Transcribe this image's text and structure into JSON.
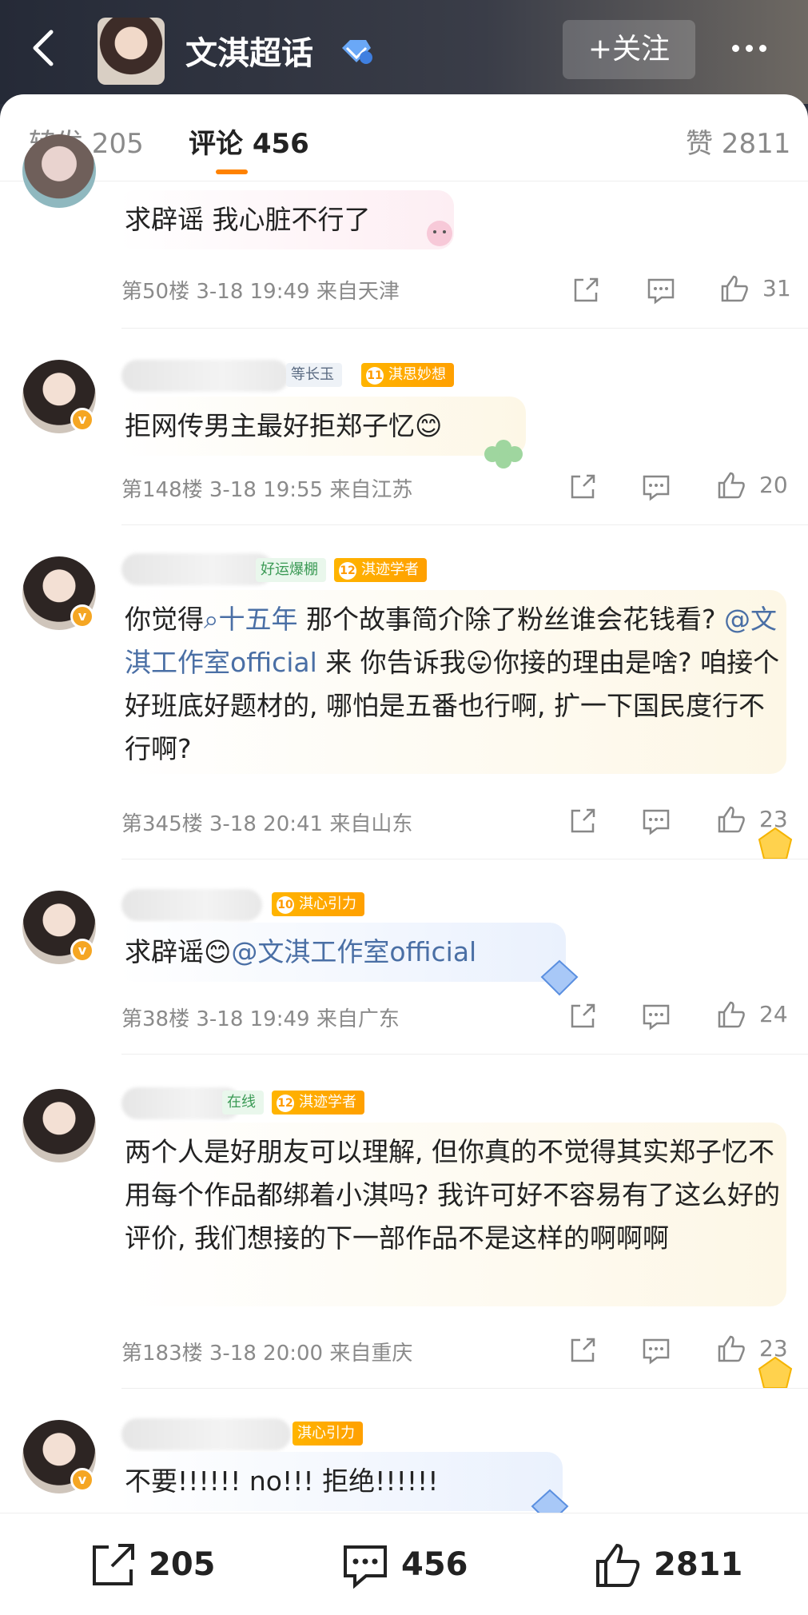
{
  "header": {
    "title": "文淇超话",
    "follow_label": "+关注"
  },
  "tabs": {
    "repost": "转发 205",
    "comment": "评论 456",
    "like": "赞 2811"
  },
  "comments": [
    {
      "text": "求辟谣 我心脏不行了",
      "meta": "第50楼 3-18 19:49 来自天津",
      "likes": "31"
    },
    {
      "tags": [
        "等长玉",
        "淇思妙想"
      ],
      "tag_level": "11",
      "text": "拒网传男主最好拒郑子忆😊",
      "meta": "第148楼 3-18 19:55 来自江苏",
      "likes": "20"
    },
    {
      "tags": [
        "好运爆棚",
        "淇迹学者"
      ],
      "tag_level": "12",
      "text_parts": {
        "p1": "你觉得",
        "topic": "十五年",
        "p2": " 那个故事简介除了粉丝谁会花钱看? ",
        "mention": "@文淇工作室official",
        "p3": " 来 你告诉我😛你接的理由是啥? 咱接个好班底好题材的, 哪怕是五番也行啊, 扩一下国民度行不行啊?"
      },
      "meta": "第345楼 3-18 20:41 来自山东",
      "likes": "23"
    },
    {
      "tags": [
        "淇心引力"
      ],
      "tag_level": "10",
      "text_parts": {
        "p1": "求辟谣😊",
        "mention": "@文淇工作室official"
      },
      "meta": "第38楼 3-18 19:49 来自广东",
      "likes": "24"
    },
    {
      "tags": [
        "在线",
        "淇迹学者"
      ],
      "tag_level": "12",
      "text": "两个人是好朋友可以理解, 但你真的不觉得其实郑子忆不用每个作品都绑着小淇吗? 我许可好不容易有了这么好的评价, 我们想接的下一部作品不是这样的啊啊啊",
      "meta": "第183楼 3-18 20:00 来自重庆",
      "likes": "23"
    },
    {
      "tags": [
        "淇心引力"
      ],
      "text": "不要!!!!!! no!!! 拒绝!!!!!!"
    }
  ],
  "bottom_bar": {
    "repost_count": "205",
    "comment_count": "456",
    "like_count": "2811"
  },
  "colors": {
    "accent": "#ff8200",
    "link": "#4a6fa5",
    "badge": "#f5a623"
  }
}
